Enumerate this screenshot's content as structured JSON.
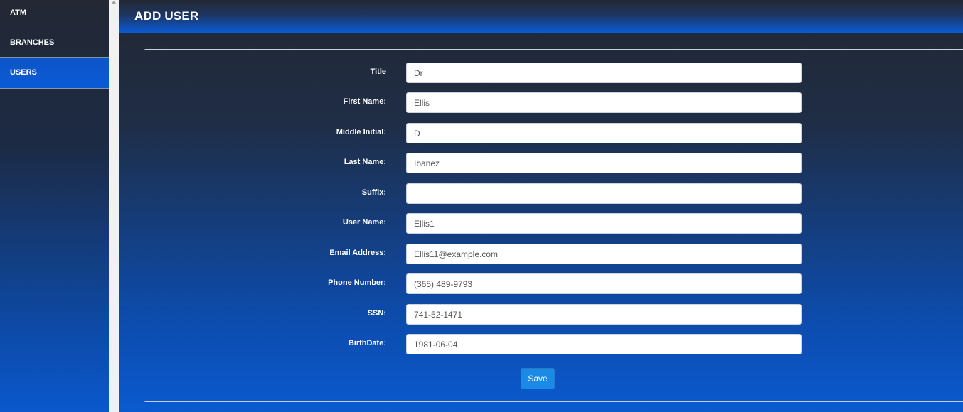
{
  "sidebar": {
    "items": [
      {
        "label": "ATM"
      },
      {
        "label": "BRANCHES"
      },
      {
        "label": "USERS",
        "active": true
      }
    ]
  },
  "header": {
    "title": "ADD USER"
  },
  "form": {
    "fields": [
      {
        "label": "Title",
        "value": "Dr"
      },
      {
        "label": "First Name:",
        "value": "Ellis"
      },
      {
        "label": "Middle Initial:",
        "value": "D"
      },
      {
        "label": "Last Name:",
        "value": "Ibanez"
      },
      {
        "label": "Suffix:",
        "value": ""
      },
      {
        "label": "User Name:",
        "value": "Ellis1"
      },
      {
        "label": "Email Address:",
        "value": "Ellis11@example.com"
      },
      {
        "label": "Phone Number:",
        "value": "(365) 489-9793"
      },
      {
        "label": "SSN:",
        "value": "741-52-1471"
      },
      {
        "label": "BirthDate:",
        "value": "1981-06-04"
      }
    ],
    "save_label": "Save"
  },
  "colors": {
    "accent": "#1a8ae6",
    "active_nav": "#0a5ad6"
  }
}
